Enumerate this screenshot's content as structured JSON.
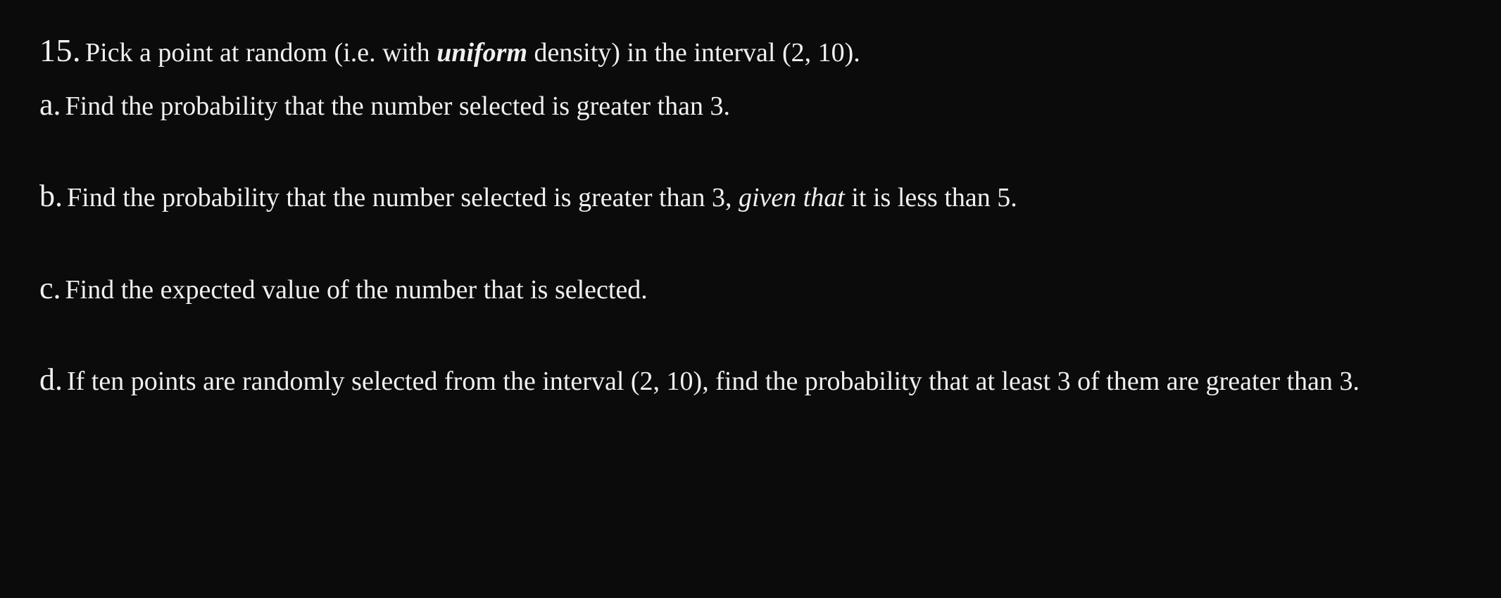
{
  "problem": {
    "number": "15.",
    "intro": {
      "prefix": "Pick a point at random (i.e. with ",
      "uniform": "uniform",
      "mid": " density) in the interval ",
      "interval": "(2, 10)",
      "suffix": "."
    },
    "parts": {
      "a": {
        "label": "a.",
        "text": "Find the probability that the number selected is greater than 3."
      },
      "b": {
        "label": "b.",
        "prefix": "Find the probability that the number selected is greater than 3, ",
        "given": "given that",
        "suffix": " it is less than 5."
      },
      "c": {
        "label": "c.",
        "text": "Find the expected value of the number that is selected."
      },
      "d": {
        "label": "d.",
        "prefix": "If ten points are randomly selected from the interval ",
        "interval": "(2, 10)",
        "suffix": ", find the probability that at least 3 of them are greater than 3."
      }
    }
  }
}
